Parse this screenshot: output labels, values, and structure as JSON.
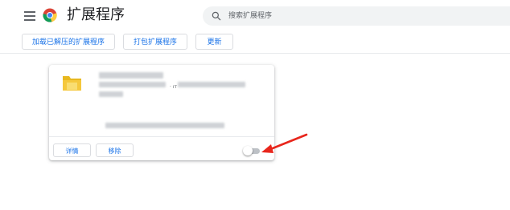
{
  "header": {
    "title": "扩展程序",
    "menu_icon": "hamburger-menu-icon",
    "logo_icon": "chrome-logo-icon"
  },
  "search": {
    "icon": "search-icon",
    "placeholder": "搜索扩展程序"
  },
  "toolbar": {
    "load_unpacked_label": "加载已解压的扩展程序",
    "pack_label": "打包扩展程序",
    "update_label": "更新"
  },
  "extension_card": {
    "icon": "folder-icon",
    "details_label": "详情",
    "remove_label": "移除",
    "enabled": false
  },
  "annotation": {
    "arrow_color": "#e8261c"
  },
  "colors": {
    "accent": "#1a73e8",
    "title_text": "#202124",
    "search_bg": "#f1f3f4"
  }
}
